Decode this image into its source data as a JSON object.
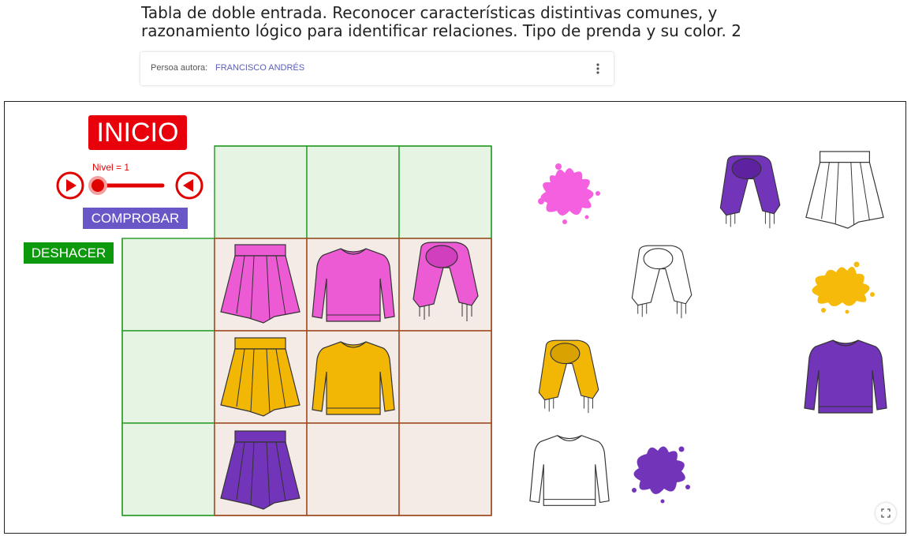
{
  "page": {
    "title_line1": "Tabla de doble entrada. Reconocer características distintivas comunes, y",
    "title_line2": "razonamiento lógico para identificar relaciones. Tipo de prenda y su color. 2"
  },
  "author": {
    "label": "Persoa autora:",
    "name": "FRANCISCO ANDRÉS"
  },
  "applet": {
    "start_label": "INICIO",
    "level_label": "Nivel = 1",
    "level_value": 1,
    "check_label": "COMPROBAR",
    "undo_label": "DESHACER"
  },
  "colors": {
    "pink": "#ec5bd4",
    "yellow": "#f2b705",
    "purple": "#7234b8",
    "grid_green": "#2e9e2e",
    "cell_green": "#e6f4e4",
    "grid_brown": "#9e4a1f",
    "cell_brown": "#f4ebe6",
    "start_red": "#e8000b",
    "check_purple": "#6956c7",
    "undo_green": "#0c9a0c"
  },
  "grid": {
    "rows": [
      [
        "skirt-pink",
        "sweater-pink",
        "scarf-pink"
      ],
      [
        "skirt-yellow",
        "sweater-yellow",
        ""
      ],
      [
        "skirt-purple",
        "",
        ""
      ]
    ]
  },
  "pieces": [
    "splash-pink",
    "scarf-purple",
    "skirt-white",
    "scarf-white",
    "splash-yellow",
    "scarf-yellow",
    "sweater-purple",
    "sweater-white",
    "splash-purple"
  ],
  "icons": {
    "more": "more-vert-icon",
    "fullscreen": "fullscreen-icon",
    "play": "play-icon",
    "play_reverse": "play-reverse-icon"
  }
}
